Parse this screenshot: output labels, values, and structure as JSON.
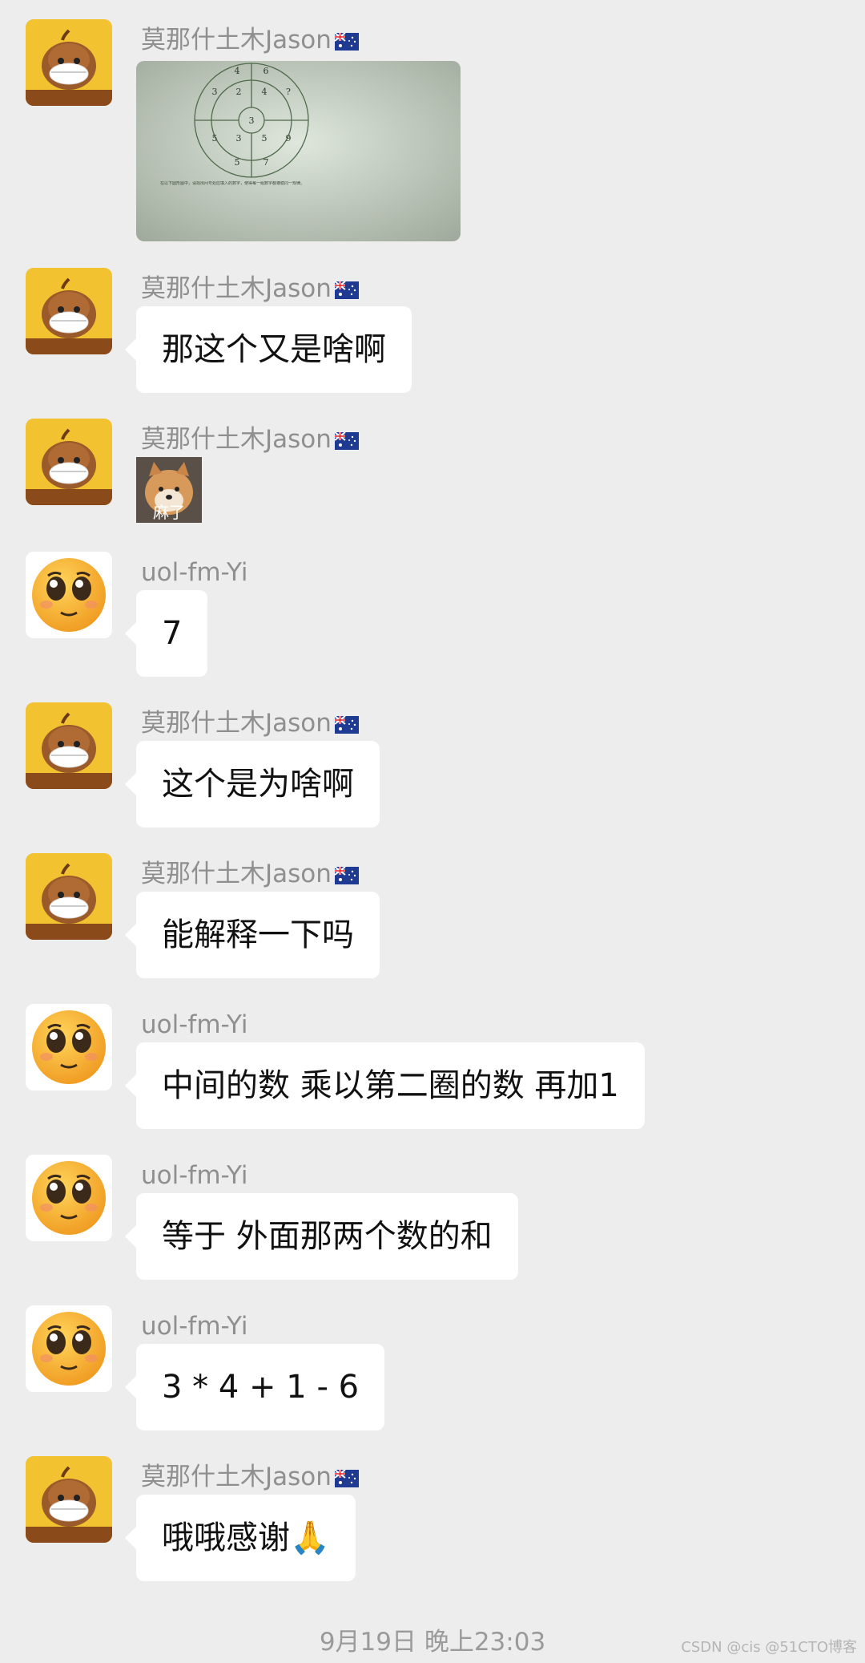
{
  "messages": [
    {
      "sender": "莫那什土木Jason",
      "kind": "image"
    },
    {
      "sender": "莫那什土木Jason",
      "kind": "text",
      "text": "那这个又是啥啊"
    },
    {
      "sender": "莫那什土木Jason",
      "kind": "sticker",
      "sticker_caption": "麻了"
    },
    {
      "sender": "uol-fm-Yi",
      "kind": "text",
      "text": "7"
    },
    {
      "sender": "莫那什土木Jason",
      "kind": "text",
      "text": "这个是为啥啊"
    },
    {
      "sender": "莫那什土木Jason",
      "kind": "text",
      "text": "能解释一下吗"
    },
    {
      "sender": "uol-fm-Yi",
      "kind": "text",
      "text": "中间的数 乘以第二圈的数 再加1"
    },
    {
      "sender": "uol-fm-Yi",
      "kind": "text",
      "text": "等于 外面那两个数的和"
    },
    {
      "sender": "uol-fm-Yi",
      "kind": "text",
      "text": "3 * 4 + 1 - 6"
    },
    {
      "sender": "莫那什土木Jason",
      "kind": "text",
      "text": "哦哦感谢🙏"
    }
  ],
  "puzzle_image": {
    "outer_numbers": [
      "4",
      "6",
      "?",
      "9",
      "7",
      "5",
      "5",
      "3"
    ],
    "middle_numbers": [
      "2",
      "4",
      "5",
      "3"
    ],
    "center_number": "3",
    "caption": "在以下圆形图中，请找出问号处应填入的数字，使得每一组数字都遵循同一规律。"
  },
  "timestamp": "9月19日 晚上23:03",
  "watermark": "CSDN @cis @51CTO博客",
  "icons": {
    "avatar_jason": "chestnut-mask-avatar",
    "avatar_yi": "pleading-face-emoji",
    "flag": "australia-flag-icon"
  },
  "colors": {
    "background": "#ededed",
    "bubble": "#ffffff",
    "sender_text": "#8f8f8f",
    "avatar_jason_bg": "#f2c230",
    "avatar_yi_face": "#f7b030"
  }
}
